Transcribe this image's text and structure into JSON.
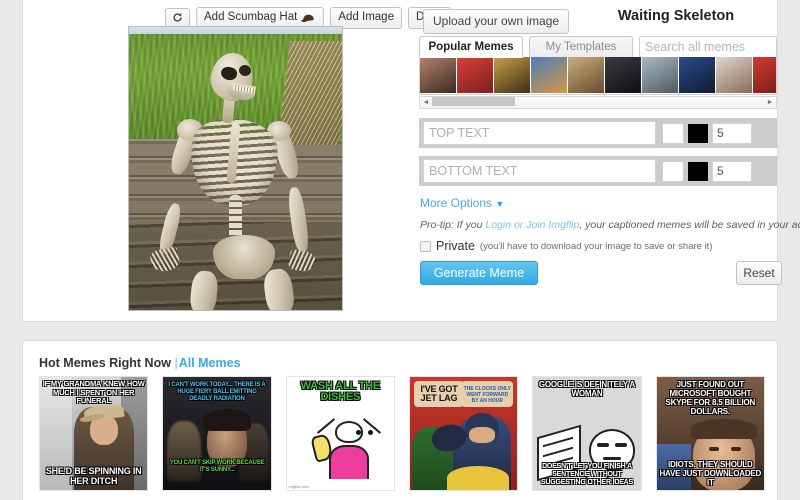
{
  "image_toolbar": {
    "refresh_icon": "refresh-icon",
    "scumbag_hat_label": "Add Scumbag Hat",
    "add_image_label": "Add Image",
    "draw_label": "Draw"
  },
  "editor": {
    "upload_label": "Upload your own image",
    "template_title": "Waiting Skeleton",
    "tabs": [
      {
        "label": "Popular Memes",
        "active": true
      },
      {
        "label": "My Templates",
        "active": false
      }
    ],
    "search": {
      "value": "",
      "placeholder": "Search all memes"
    },
    "captions": [
      {
        "name": "top",
        "value": "",
        "placeholder": "TOP TEXT",
        "fill_color": "#ffffff",
        "outline_color": "#000000",
        "stroke_width": "5"
      },
      {
        "name": "bottom",
        "value": "",
        "placeholder": "BOTTOM TEXT",
        "fill_color": "#ffffff",
        "outline_color": "#000000",
        "stroke_width": "5"
      }
    ],
    "more_options_label": "More Options",
    "more_options_chevron": "▼",
    "pro_tip": {
      "prefix": "Pro-tip: If you ",
      "link": "Login or Join Imgflip",
      "suffix": ", your captioned memes will be saved in your account"
    },
    "private": {
      "label": "Private",
      "note": "(you'll have to download your image to save or share it)",
      "checked": false
    },
    "generate_label": "Generate Meme",
    "reset_label": "Reset",
    "accent_color": "#35aadf",
    "caption_row_bg": "#cccccc"
  },
  "hot_memes": {
    "heading": "Hot Memes Right Now",
    "separator": "|",
    "all_link": "All Memes",
    "items": [
      {
        "name": "scumbag-steve",
        "top_text": "IF MY GRANDMA KNEW HOW MUCH I SPENT ON HER FUNERAL",
        "bottom_text": "SHE'D BE SPINNING IN HER DITCH"
      },
      {
        "name": "sunny-work-excuse",
        "top_text": "I CAN'T WORK TODAY... THERE IS A HUGE FIERY BALL EMITTING DEADLY RADIATION",
        "bottom_text": "YOU CAN'T SKIP WORK BECAUSE IT'S SUNNY..."
      },
      {
        "name": "x-all-the-y",
        "top_text": "WASH ALL THE DISHES",
        "bottom_text": "",
        "watermark": "imgflip.com"
      },
      {
        "name": "batman-slapping-robin",
        "top_text": "I'VE GOT JET LAG",
        "bottom_text": "THE CLOCKS ONLY WENT FORWARD BY AN HOUR"
      },
      {
        "name": "google-is-a-woman",
        "top_text": "GOOGLE IS DEFINITELY A WOMAN",
        "bottom_text": "DOESN'T LET YOU FINISH A SENTENCE WITHOUT SUGGESTING OTHER IDEAS"
      },
      {
        "name": "10-guy",
        "top_text": "JUST FOUND OUT MICROSOFT BOUGHT SKYPE FOR 8.5 BILLION DOLLARS.",
        "bottom_text": "IDIOTS. THEY SHOULD HAVE JUST DOWNLOADED IT"
      }
    ]
  },
  "scrollbar": {
    "left_arrow": "◄",
    "right_arrow": "►"
  }
}
